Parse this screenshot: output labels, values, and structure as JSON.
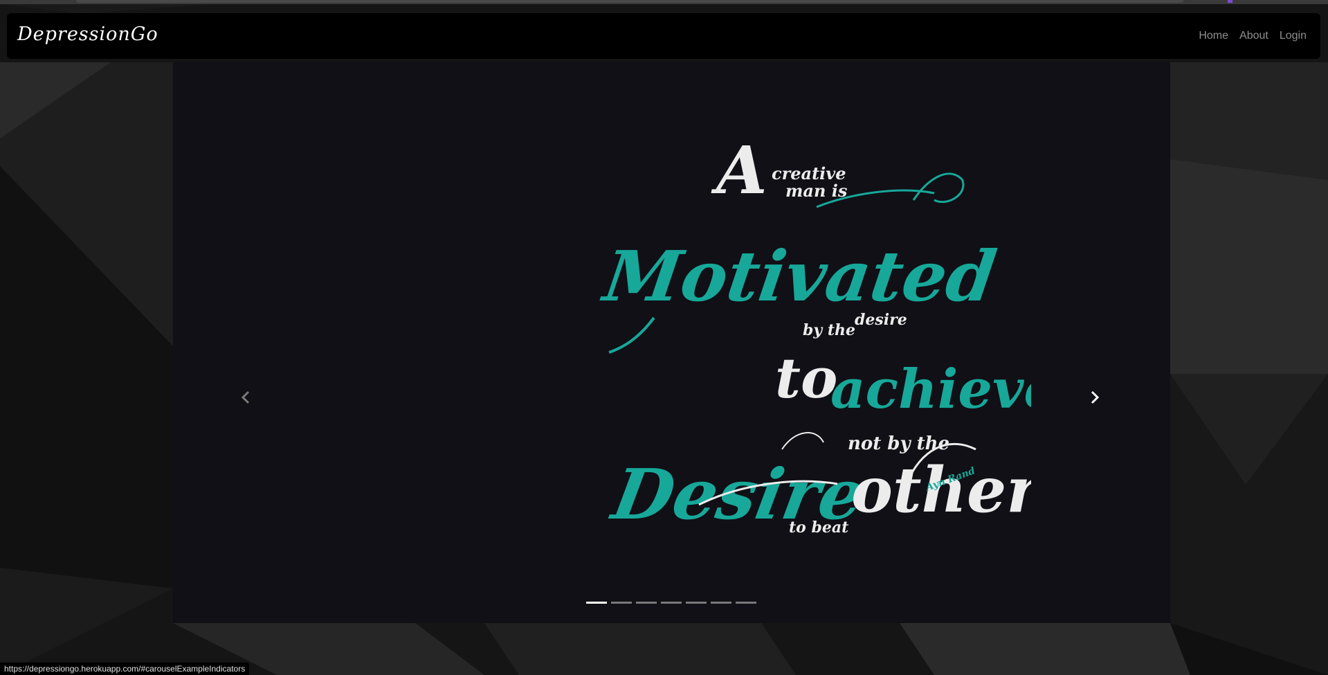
{
  "navbar": {
    "brand": "DepressionGo",
    "links": [
      {
        "label": "Home"
      },
      {
        "label": "About"
      },
      {
        "label": "Login"
      }
    ]
  },
  "carousel": {
    "slide": {
      "quote_lines": [
        "A",
        "creative",
        "man is",
        "Motivated",
        "by the",
        "desire",
        "to",
        "achieve",
        "not by the",
        "Desire",
        "to beat",
        "others"
      ],
      "author": "Ayn Rand"
    },
    "prev_icon": "chevron-left-icon",
    "next_icon": "chevron-right-icon",
    "indicator_count": 7,
    "active_indicator": 1
  },
  "status_bar": {
    "url": "https://depressiongo.herokuapp.com/#carouselExampleIndicators"
  },
  "colors": {
    "teal": "#17a89a",
    "cream": "#ececec",
    "slide_bg": "#101016",
    "navbar_bg": "#000000"
  }
}
